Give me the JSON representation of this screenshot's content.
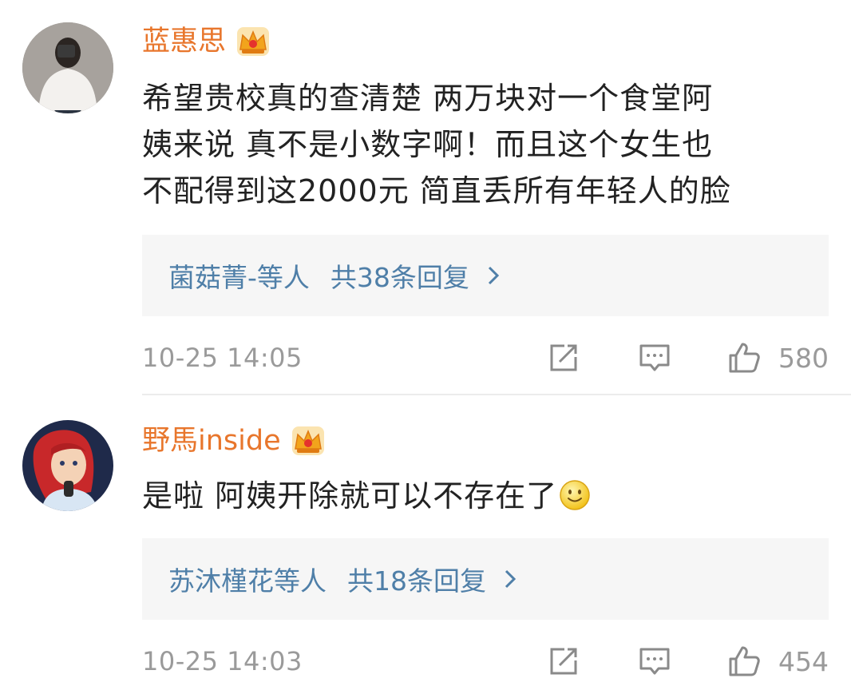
{
  "comments": [
    {
      "username": "蓝惠思",
      "badge_icon": "vip-crown-icon",
      "lines": [
        "希望贵校真的查清楚 两万块对一个食堂阿",
        "姨来说 真不是小数字啊！而且这个女生也",
        "不配得到这2000元 简直丢所有年轻人的脸"
      ],
      "reply_users": "菌菇菁-等人",
      "reply_count": "共38条回复",
      "time": "10-25 14:05",
      "likes": "580"
    },
    {
      "username": "野馬inside",
      "badge_icon": "vip-crown-icon",
      "lines": [
        "是啦 阿姨开除就可以不存在了"
      ],
      "emoji": "smiley-icon",
      "reply_users": "苏沐槿花等人",
      "reply_count": "共18条回复",
      "time": "10-25 14:03",
      "likes": "454"
    }
  ],
  "colors": {
    "username": "#e8762c",
    "link": "#4f7fa8",
    "muted": "#9a9a9a",
    "reply_bg": "#f6f6f6"
  }
}
